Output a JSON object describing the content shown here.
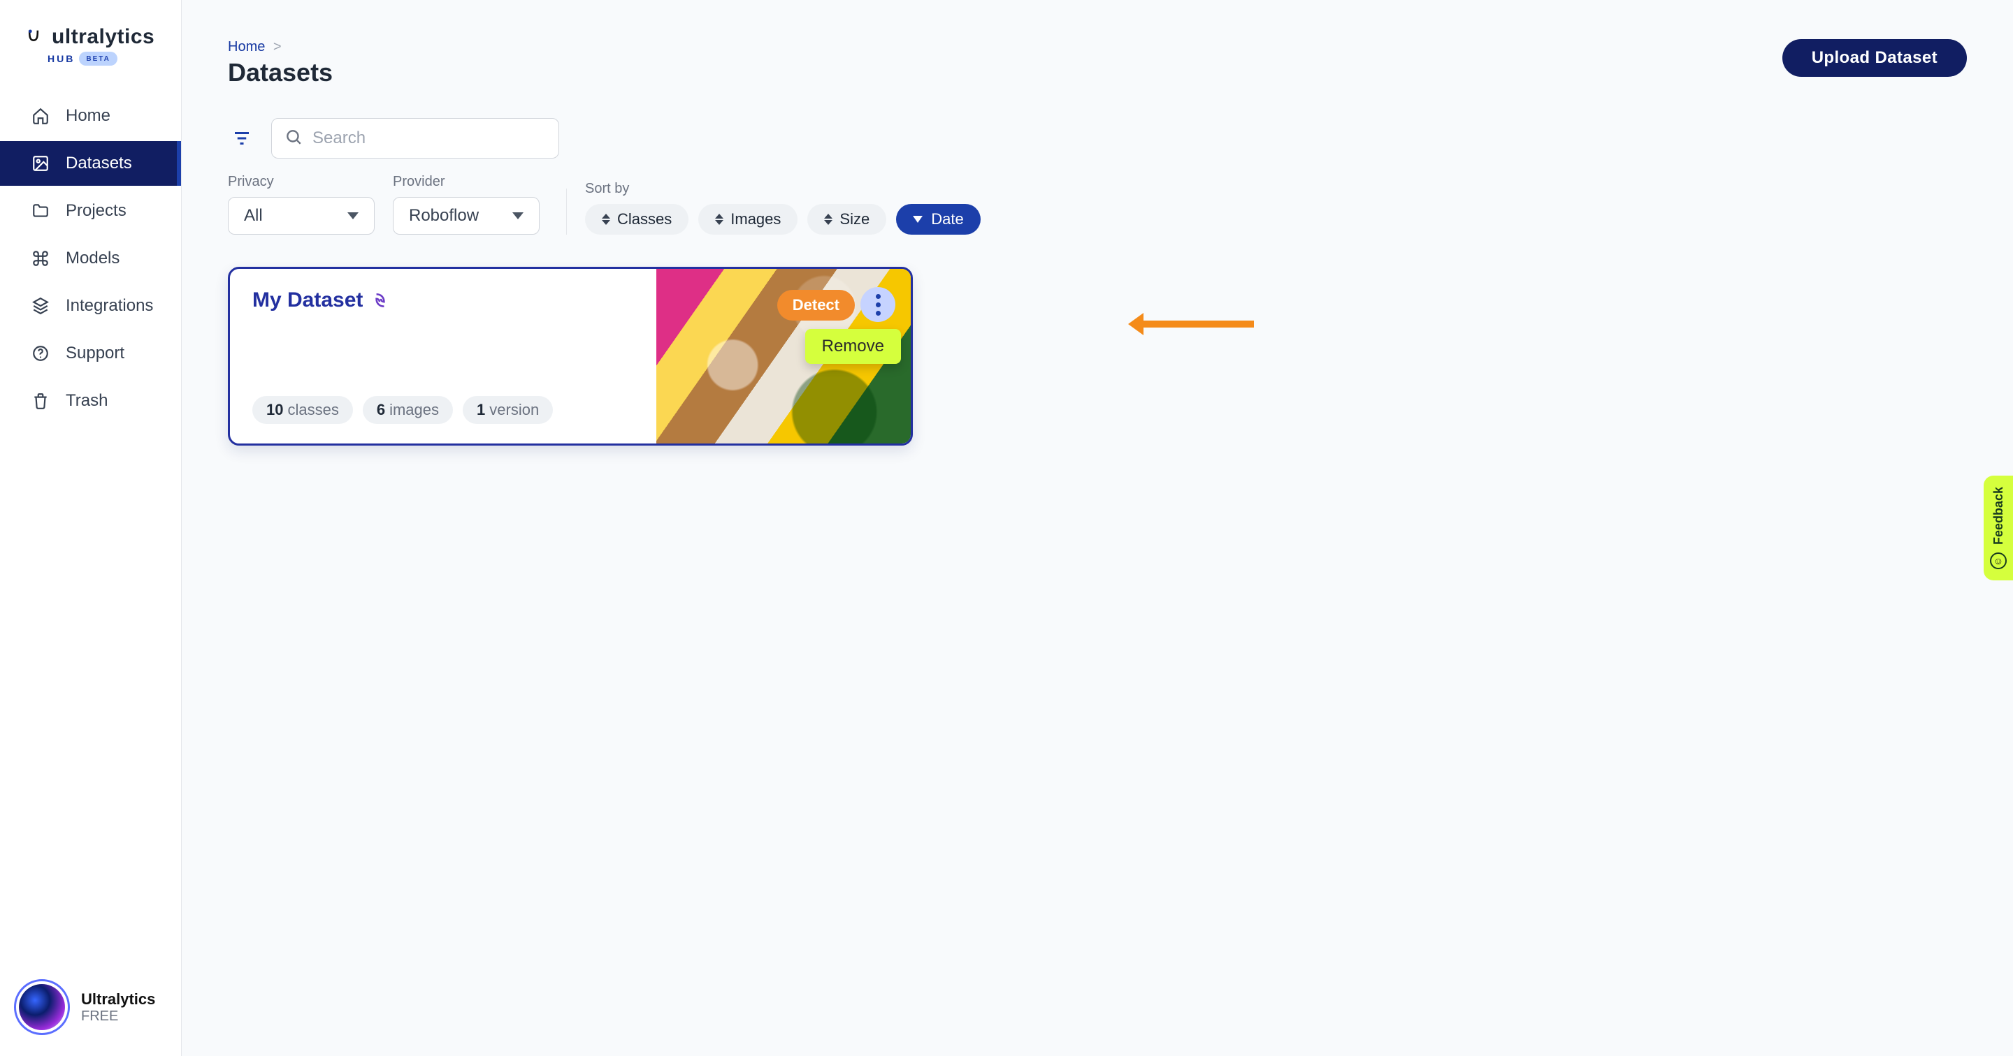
{
  "brand": {
    "name": "ultralytics",
    "sub": "HUB",
    "tag": "BETA"
  },
  "sidebar": {
    "items": [
      {
        "label": "Home",
        "icon": "home-icon",
        "active": false
      },
      {
        "label": "Datasets",
        "icon": "image-icon",
        "active": true
      },
      {
        "label": "Projects",
        "icon": "folder-icon",
        "active": false
      },
      {
        "label": "Models",
        "icon": "command-icon",
        "active": false
      },
      {
        "label": "Integrations",
        "icon": "layers-icon",
        "active": false
      },
      {
        "label": "Support",
        "icon": "help-icon",
        "active": false
      },
      {
        "label": "Trash",
        "icon": "trash-icon",
        "active": false
      }
    ],
    "user_name": "Ultralytics",
    "user_plan": "FREE"
  },
  "header": {
    "breadcrumb_home": "Home",
    "breadcrumb_sep": ">",
    "title": "Datasets",
    "upload_btn": "Upload Dataset"
  },
  "toolbar": {
    "search_placeholder": "Search",
    "filters": {
      "privacy_label": "Privacy",
      "privacy_value": "All",
      "provider_label": "Provider",
      "provider_value": "Roboflow",
      "sortby_label": "Sort by",
      "sort_options": [
        "Classes",
        "Images",
        "Size",
        "Date"
      ],
      "sort_active": "Date"
    }
  },
  "cards": [
    {
      "title": "My Dataset",
      "provider_icon": "roboflow-icon",
      "stats": [
        {
          "value": "10",
          "label": "classes"
        },
        {
          "value": "6",
          "label": "images"
        },
        {
          "value": "1",
          "label": "version"
        }
      ],
      "badge": "Detect",
      "menu": {
        "remove_label": "Remove"
      }
    }
  ],
  "feedback": {
    "label": "Feedback"
  },
  "colors": {
    "primary": "#111e62",
    "accent": "#1c3faa",
    "highlight": "#d5ff3d",
    "warn": "#f48b1a",
    "badge": "#f28b2c"
  }
}
